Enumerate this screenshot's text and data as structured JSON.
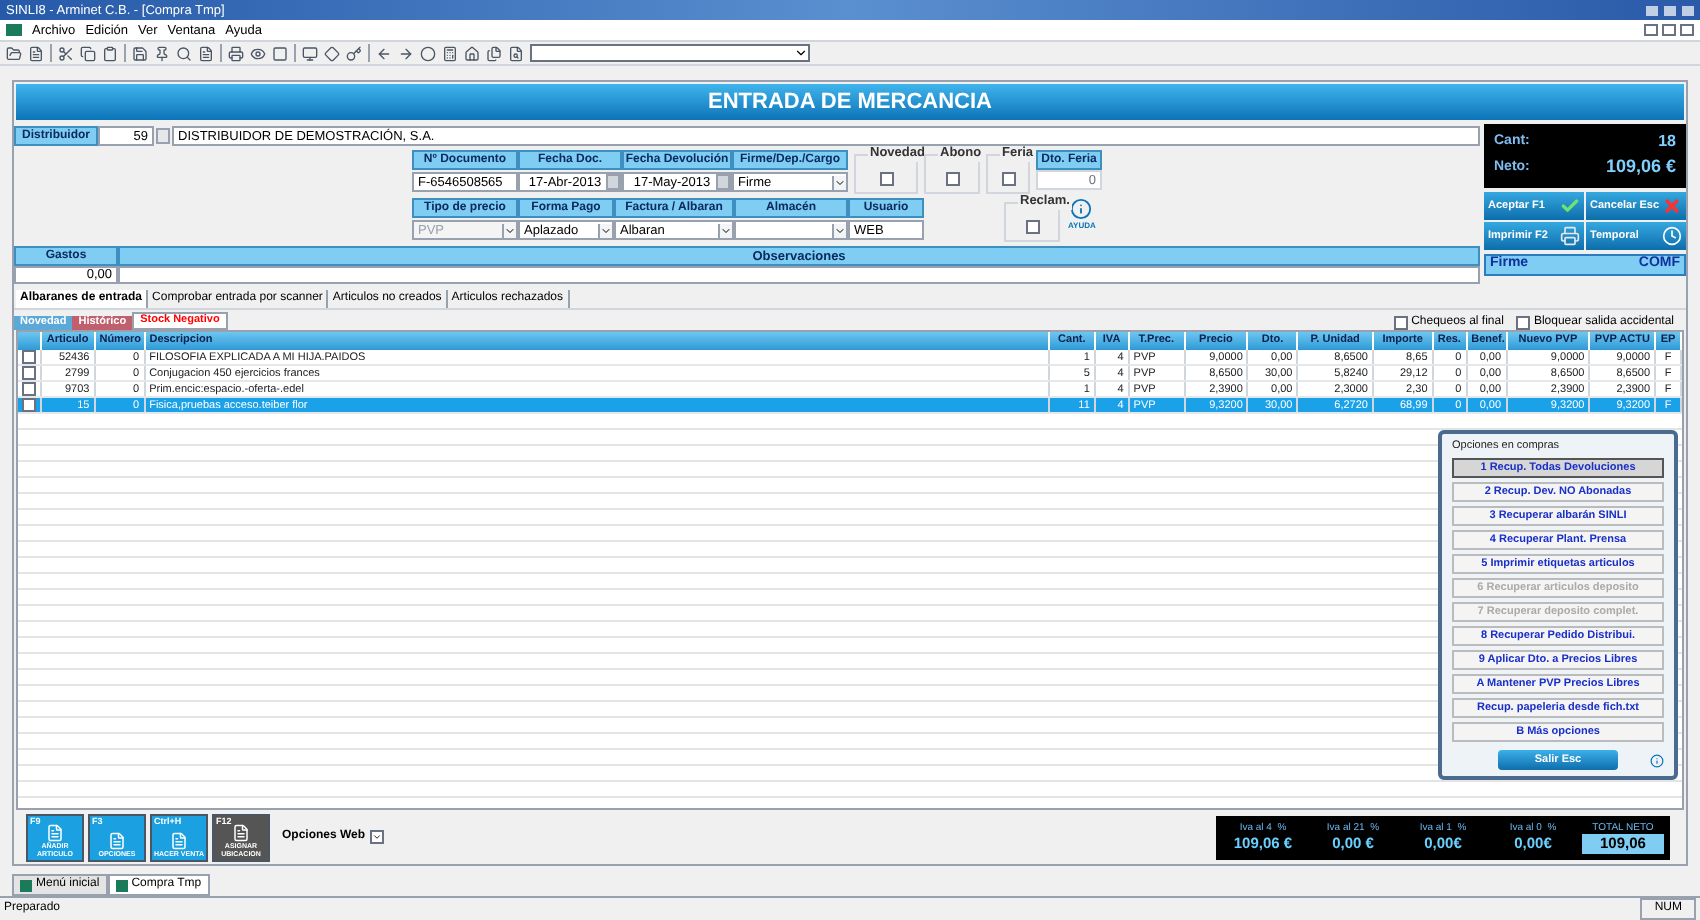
{
  "window": {
    "title": "SINLI8 - Arminet C.B. - [Compra Tmp]"
  },
  "menu": [
    "Archivo",
    "Edición",
    "Ver",
    "Ventana",
    "Ayuda"
  ],
  "form": {
    "title": "ENTRADA DE MERCANCIA",
    "distributor": {
      "label": "Distribuidor",
      "code": "59",
      "name": "DISTRIBUIDOR DE DEMOSTRACIÓN, S.A."
    },
    "row1": [
      {
        "label": "Nº Documento",
        "value": "F-6546508565",
        "kind": "text"
      },
      {
        "label": "Fecha Doc.",
        "value": "17-Abr-2013",
        "kind": "spin"
      },
      {
        "label": "Fecha Devolución",
        "value": "17-May-2013",
        "kind": "spin"
      },
      {
        "label": "Firme/Dep./Cargo",
        "value": "Firme",
        "kind": "select"
      }
    ],
    "flags": [
      {
        "label": "Novedad",
        "checked": false
      },
      {
        "label": "Abono",
        "checked": false
      },
      {
        "label": "Feria",
        "checked": false
      }
    ],
    "dto_feria": {
      "label": "Dto. Feria",
      "value": "0"
    },
    "row2": [
      {
        "label": "Tipo de precio",
        "value": "PVP",
        "kind": "select",
        "disabled": true
      },
      {
        "label": "Forma Pago",
        "value": "Aplazado",
        "kind": "select"
      },
      {
        "label": "Factura / Albaran",
        "value": "Albaran",
        "kind": "select"
      },
      {
        "label": "Almacén",
        "kind": "select"
      },
      {
        "label": "Usuario",
        "value": "WEB",
        "kind": "text"
      }
    ],
    "reclam": {
      "label": "Reclam.",
      "checked": false
    },
    "help_label": "AYUDA",
    "gastos": {
      "label": "Gastos",
      "value": "0,00"
    },
    "observaciones": {
      "label": "Observaciones"
    }
  },
  "summary": {
    "cant_label": "Cant:",
    "cant": "18",
    "neto_label": "Neto:",
    "neto": "109,06 €"
  },
  "actions": [
    {
      "label": "Aceptar F1",
      "kind": "accept"
    },
    {
      "label": "Cancelar Esc",
      "kind": "cancel"
    },
    {
      "label": "Imprimir F2",
      "kind": "print"
    },
    {
      "label": "Temporal",
      "kind": "clock"
    }
  ],
  "status_banner": {
    "state": "Firme",
    "code": "COMF"
  },
  "tabs": [
    {
      "label": "Albaranes de entrada",
      "selected": true
    },
    {
      "label": "Comprobar entrada por scanner",
      "selected": false
    },
    {
      "label": "Articulos no creados",
      "selected": false
    },
    {
      "label": "Articulos rechazados",
      "selected": false
    }
  ],
  "filters": [
    {
      "label": "Novedad",
      "kind": "filled",
      "color": "#5aa9d6"
    },
    {
      "label": "Histórico",
      "kind": "filled",
      "color": "#c0606e"
    },
    {
      "label": "Stock Negativo",
      "kind": "outlined",
      "color": "#ff0000"
    }
  ],
  "options": [
    {
      "label": "Chequeos al final",
      "checked": false
    },
    {
      "label": "Bloquear salida accidental",
      "checked": false
    }
  ],
  "table": {
    "columns": [
      "Articulo",
      "Número",
      "Descripcion",
      "Cant.",
      "IVA",
      "T.Prec.",
      "Precio",
      "Dto.",
      "P. Unidad",
      "Importe",
      "Res.",
      "Benef.",
      "Nuevo PVP",
      "PVP ACTU",
      "EP"
    ],
    "rows": [
      {
        "checked": false,
        "selected": false,
        "cells": [
          "52436",
          "0",
          "FILOSOFIA EXPLICADA A MI HIJA.PAIDOS",
          "1",
          "4",
          "PVP",
          "9,0000",
          "0,00",
          "8,6500",
          "8,65",
          "0",
          "0,00",
          "9,0000",
          "9,0000",
          "F"
        ]
      },
      {
        "checked": false,
        "selected": false,
        "cells": [
          "2799",
          "0",
          "Conjugacion 450 ejercicios frances",
          "5",
          "4",
          "PVP",
          "8,6500",
          "30,00",
          "5,8240",
          "29,12",
          "0",
          "0,00",
          "8,6500",
          "8,6500",
          "F"
        ]
      },
      {
        "checked": false,
        "selected": false,
        "cells": [
          "9703",
          "0",
          "Prim.encic:espacio.-oferta-.edel",
          "1",
          "4",
          "PVP",
          "2,3900",
          "0,00",
          "2,3000",
          "2,30",
          "0",
          "0,00",
          "2,3900",
          "2,3900",
          "F"
        ]
      },
      {
        "checked": false,
        "selected": true,
        "cells": [
          "15",
          "0",
          "Fisica,pruebas acceso.teiber flor",
          "11",
          "4",
          "PVP",
          "9,3200",
          "30,00",
          "6,2720",
          "68,99",
          "0",
          "0,00",
          "9,3200",
          "9,3200",
          "F"
        ]
      }
    ]
  },
  "popup": {
    "title": "Opciones en compras",
    "items": [
      {
        "label": "1 Recup. Todas Devoluciones",
        "selected": true,
        "disabled": false
      },
      {
        "label": "2 Recup. Dev. NO Abonadas",
        "selected": false,
        "disabled": false
      },
      {
        "label": "3 Recuperar albarán SINLI",
        "selected": false,
        "disabled": false
      },
      {
        "label": "4 Recuperar Plant. Prensa",
        "selected": false,
        "disabled": false
      },
      {
        "label": "5 Imprimir etiquetas articulos",
        "selected": false,
        "disabled": false
      },
      {
        "label": "6 Recuperar articulos deposito",
        "selected": false,
        "disabled": true
      },
      {
        "label": "7 Recuperar deposito complet.",
        "selected": false,
        "disabled": true
      },
      {
        "label": "8 Recuperar Pedido Distribui.",
        "selected": false,
        "disabled": false
      },
      {
        "label": "9 Aplicar Dto. a Precios Libres",
        "selected": false,
        "disabled": false
      },
      {
        "label": "A Mantener PVP Precios Libres",
        "selected": false,
        "disabled": false
      },
      {
        "label": "Recup. papeleria desde fich.txt",
        "selected": false,
        "disabled": false
      },
      {
        "label": "B Más opciones",
        "selected": false,
        "disabled": false
      }
    ],
    "exit": "Salir Esc"
  },
  "function_buttons": [
    {
      "key": "F9",
      "label": "AÑADIR ARTICULO",
      "color": "#1ba1e2"
    },
    {
      "key": "F3",
      "label": "OPCIONES",
      "color": "#1ba1e2"
    },
    {
      "key": "Ctrl+H",
      "label": "HACER VENTA",
      "color": "#1ba1e2"
    },
    {
      "key": "F12",
      "label": "ASIGNAR UBICACION",
      "color": "#555555"
    }
  ],
  "web_options": "Opciones Web",
  "totals": [
    {
      "label": "Iva al 4  %",
      "value": "109,06 €",
      "kind": "tax"
    },
    {
      "label": "Iva al 21  %",
      "value": "0,00 €",
      "kind": "tax"
    },
    {
      "label": "Iva al 1  %",
      "value": "0,00€",
      "kind": "tax"
    },
    {
      "label": "Iva al 0  %",
      "value": "0,00€",
      "kind": "tax"
    },
    {
      "label": "TOTAL NETO",
      "value": "109,06",
      "kind": "total"
    }
  ],
  "mdi_tabs": [
    {
      "label": "Menú inicial",
      "selected": false
    },
    {
      "label": "Compra Tmp",
      "selected": true
    }
  ],
  "status_bar": {
    "message": "Preparado",
    "indicator": "NUM"
  }
}
